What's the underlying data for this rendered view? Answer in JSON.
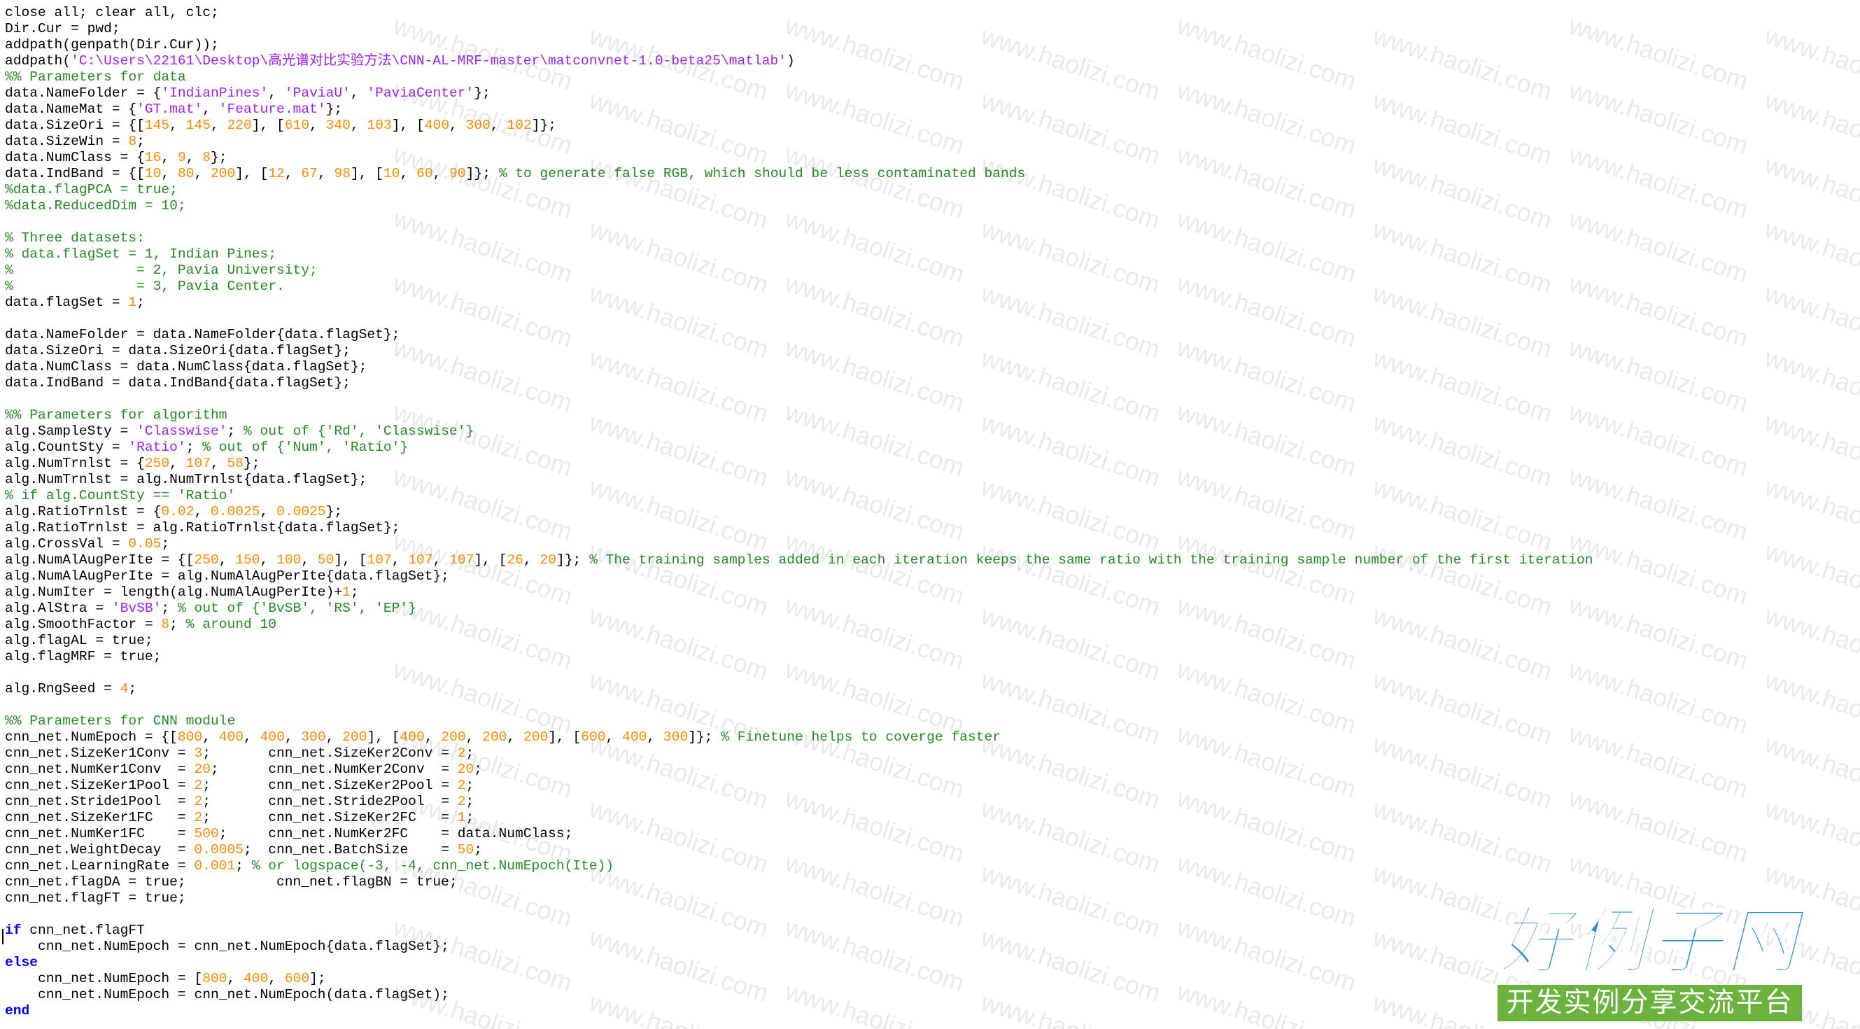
{
  "editor": {
    "colors": {
      "keyword": "#0000ff",
      "string": "#a020f0",
      "comment": "#228b22",
      "number": "#ff8c00",
      "text": "#000000",
      "background": "#ffffff"
    },
    "lines": [
      [
        [
          "t",
          "close all; clear all, clc;"
        ]
      ],
      [
        [
          "t",
          "Dir.Cur = pwd;"
        ]
      ],
      [
        [
          "t",
          "addpath(genpath(Dir.Cur));"
        ]
      ],
      [
        [
          "t",
          "addpath("
        ],
        [
          "s",
          "'C:\\Users\\22161\\Desktop\\高光谱对比实验方法\\CNN-AL-MRF-master\\matconvnet-1.0-beta25\\matlab'"
        ],
        [
          "t",
          ")"
        ]
      ],
      [
        [
          "c",
          "%% Parameters for data"
        ]
      ],
      [
        [
          "t",
          "data.NameFolder = {"
        ],
        [
          "s",
          "'IndianPines'"
        ],
        [
          "t",
          ", "
        ],
        [
          "s",
          "'PaviaU'"
        ],
        [
          "t",
          ", "
        ],
        [
          "s",
          "'PaviaCenter'"
        ],
        [
          "t",
          "};"
        ]
      ],
      [
        [
          "t",
          "data.NameMat = {"
        ],
        [
          "s",
          "'GT.mat'"
        ],
        [
          "t",
          ", "
        ],
        [
          "s",
          "'Feature.mat'"
        ],
        [
          "t",
          "};"
        ]
      ],
      [
        [
          "t",
          "data.SizeOri = {["
        ],
        [
          "n",
          "145"
        ],
        [
          "t",
          ", "
        ],
        [
          "n",
          "145"
        ],
        [
          "t",
          ", "
        ],
        [
          "n",
          "220"
        ],
        [
          "t",
          "], ["
        ],
        [
          "n",
          "610"
        ],
        [
          "t",
          ", "
        ],
        [
          "n",
          "340"
        ],
        [
          "t",
          ", "
        ],
        [
          "n",
          "103"
        ],
        [
          "t",
          "], ["
        ],
        [
          "n",
          "400"
        ],
        [
          "t",
          ", "
        ],
        [
          "n",
          "300"
        ],
        [
          "t",
          ", "
        ],
        [
          "n",
          "102"
        ],
        [
          "t",
          "]};"
        ]
      ],
      [
        [
          "t",
          "data.SizeWin = "
        ],
        [
          "n",
          "8"
        ],
        [
          "t",
          ";"
        ]
      ],
      [
        [
          "t",
          "data.NumClass = {"
        ],
        [
          "n",
          "16"
        ],
        [
          "t",
          ", "
        ],
        [
          "n",
          "9"
        ],
        [
          "t",
          ", "
        ],
        [
          "n",
          "8"
        ],
        [
          "t",
          "};"
        ]
      ],
      [
        [
          "t",
          "data.IndBand = {["
        ],
        [
          "n",
          "10"
        ],
        [
          "t",
          ", "
        ],
        [
          "n",
          "80"
        ],
        [
          "t",
          ", "
        ],
        [
          "n",
          "200"
        ],
        [
          "t",
          "], ["
        ],
        [
          "n",
          "12"
        ],
        [
          "t",
          ", "
        ],
        [
          "n",
          "67"
        ],
        [
          "t",
          ", "
        ],
        [
          "n",
          "98"
        ],
        [
          "t",
          "], ["
        ],
        [
          "n",
          "10"
        ],
        [
          "t",
          ", "
        ],
        [
          "n",
          "60"
        ],
        [
          "t",
          ", "
        ],
        [
          "n",
          "90"
        ],
        [
          "t",
          "]}; "
        ],
        [
          "c",
          "% to generate false RGB, which should be less contaminated bands"
        ]
      ],
      [
        [
          "c",
          "%data.flagPCA = true;"
        ]
      ],
      [
        [
          "c",
          "%data.ReducedDim = 10;"
        ]
      ],
      [],
      [
        [
          "c",
          "% Three datasets:"
        ]
      ],
      [
        [
          "c",
          "% data.flagSet = 1, Indian Pines;"
        ]
      ],
      [
        [
          "c",
          "%               = 2, Pavia University;"
        ]
      ],
      [
        [
          "c",
          "%               = 3, Pavia Center."
        ]
      ],
      [
        [
          "t",
          "data.flagSet = "
        ],
        [
          "n",
          "1"
        ],
        [
          "t",
          ";"
        ]
      ],
      [],
      [
        [
          "t",
          "data.NameFolder = data.NameFolder{data.flagSet};"
        ]
      ],
      [
        [
          "t",
          "data.SizeOri = data.SizeOri{data.flagSet};"
        ]
      ],
      [
        [
          "t",
          "data.NumClass = data.NumClass{data.flagSet};"
        ]
      ],
      [
        [
          "t",
          "data.IndBand = data.IndBand{data.flagSet};"
        ]
      ],
      [],
      [
        [
          "c",
          "%% Parameters for algorithm"
        ]
      ],
      [
        [
          "t",
          "alg.SampleSty = "
        ],
        [
          "s",
          "'Classwise'"
        ],
        [
          "t",
          "; "
        ],
        [
          "c",
          "% out of {'Rd', 'Classwise'}"
        ]
      ],
      [
        [
          "t",
          "alg.CountSty = "
        ],
        [
          "s",
          "'Ratio'"
        ],
        [
          "t",
          "; "
        ],
        [
          "c",
          "% out of {'Num', 'Ratio'}"
        ]
      ],
      [
        [
          "t",
          "alg.NumTrnlst = {"
        ],
        [
          "n",
          "250"
        ],
        [
          "t",
          ", "
        ],
        [
          "n",
          "107"
        ],
        [
          "t",
          ", "
        ],
        [
          "n",
          "58"
        ],
        [
          "t",
          "};"
        ]
      ],
      [
        [
          "t",
          "alg.NumTrnlst = alg.NumTrnlst{data.flagSet};"
        ]
      ],
      [
        [
          "c",
          "% if alg.CountSty == 'Ratio'"
        ]
      ],
      [
        [
          "t",
          "alg.RatioTrnlst = {"
        ],
        [
          "n",
          "0.02"
        ],
        [
          "t",
          ", "
        ],
        [
          "n",
          "0.0025"
        ],
        [
          "t",
          ", "
        ],
        [
          "n",
          "0.0025"
        ],
        [
          "t",
          "};"
        ]
      ],
      [
        [
          "t",
          "alg.RatioTrnlst = alg.RatioTrnlst{data.flagSet};"
        ]
      ],
      [
        [
          "t",
          "alg.CrossVal = "
        ],
        [
          "n",
          "0.05"
        ],
        [
          "t",
          ";"
        ]
      ],
      [
        [
          "t",
          "alg.NumAlAugPerIte = {["
        ],
        [
          "n",
          "250"
        ],
        [
          "t",
          ", "
        ],
        [
          "n",
          "150"
        ],
        [
          "t",
          ", "
        ],
        [
          "n",
          "100"
        ],
        [
          "t",
          ", "
        ],
        [
          "n",
          "50"
        ],
        [
          "t",
          "], ["
        ],
        [
          "n",
          "107"
        ],
        [
          "t",
          ", "
        ],
        [
          "n",
          "107"
        ],
        [
          "t",
          ", "
        ],
        [
          "n",
          "107"
        ],
        [
          "t",
          "], ["
        ],
        [
          "n",
          "26"
        ],
        [
          "t",
          ", "
        ],
        [
          "n",
          "20"
        ],
        [
          "t",
          "]}; "
        ],
        [
          "c",
          "% The training samples added in each iteration keeps the same ratio with the training sample number of the first iteration"
        ]
      ],
      [
        [
          "t",
          "alg.NumAlAugPerIte = alg.NumAlAugPerIte{data.flagSet};"
        ]
      ],
      [
        [
          "t",
          "alg.NumIter = length(alg.NumAlAugPerIte)+"
        ],
        [
          "n",
          "1"
        ],
        [
          "t",
          ";"
        ]
      ],
      [
        [
          "t",
          "alg.AlStra = "
        ],
        [
          "s",
          "'BvSB'"
        ],
        [
          "t",
          "; "
        ],
        [
          "c",
          "% out of {'BvSB', 'RS', 'EP'}"
        ]
      ],
      [
        [
          "t",
          "alg.SmoothFactor = "
        ],
        [
          "n",
          "8"
        ],
        [
          "t",
          "; "
        ],
        [
          "c",
          "% around 10"
        ]
      ],
      [
        [
          "t",
          "alg.flagAL = true;"
        ]
      ],
      [
        [
          "t",
          "alg.flagMRF = true;"
        ]
      ],
      [],
      [
        [
          "t",
          "alg.RngSeed = "
        ],
        [
          "n",
          "4"
        ],
        [
          "t",
          ";"
        ]
      ],
      [],
      [
        [
          "c",
          "%% Parameters for CNN module"
        ]
      ],
      [
        [
          "t",
          "cnn_net.NumEpoch = {["
        ],
        [
          "n",
          "800"
        ],
        [
          "t",
          ", "
        ],
        [
          "n",
          "400"
        ],
        [
          "t",
          ", "
        ],
        [
          "n",
          "400"
        ],
        [
          "t",
          ", "
        ],
        [
          "n",
          "300"
        ],
        [
          "t",
          ", "
        ],
        [
          "n",
          "200"
        ],
        [
          "t",
          "], ["
        ],
        [
          "n",
          "400"
        ],
        [
          "t",
          ", "
        ],
        [
          "n",
          "200"
        ],
        [
          "t",
          ", "
        ],
        [
          "n",
          "200"
        ],
        [
          "t",
          ", "
        ],
        [
          "n",
          "200"
        ],
        [
          "t",
          "], ["
        ],
        [
          "n",
          "600"
        ],
        [
          "t",
          ", "
        ],
        [
          "n",
          "400"
        ],
        [
          "t",
          ", "
        ],
        [
          "n",
          "300"
        ],
        [
          "t",
          "]}; "
        ],
        [
          "c",
          "% Finetune helps to coverge faster"
        ]
      ],
      [
        [
          "t",
          "cnn_net.SizeKer1Conv = "
        ],
        [
          "n",
          "3"
        ],
        [
          "t",
          ";       cnn_net.SizeKer2Conv = "
        ],
        [
          "n",
          "2"
        ],
        [
          "t",
          ";"
        ]
      ],
      [
        [
          "t",
          "cnn_net.NumKer1Conv  = "
        ],
        [
          "n",
          "20"
        ],
        [
          "t",
          ";      cnn_net.NumKer2Conv  = "
        ],
        [
          "n",
          "20"
        ],
        [
          "t",
          ";"
        ]
      ],
      [
        [
          "t",
          "cnn_net.SizeKer1Pool = "
        ],
        [
          "n",
          "2"
        ],
        [
          "t",
          ";       cnn_net.SizeKer2Pool = "
        ],
        [
          "n",
          "2"
        ],
        [
          "t",
          ";"
        ]
      ],
      [
        [
          "t",
          "cnn_net.Stride1Pool  = "
        ],
        [
          "n",
          "2"
        ],
        [
          "t",
          ";       cnn_net.Stride2Pool  = "
        ],
        [
          "n",
          "2"
        ],
        [
          "t",
          ";"
        ]
      ],
      [
        [
          "t",
          "cnn_net.SizeKer1FC   = "
        ],
        [
          "n",
          "2"
        ],
        [
          "t",
          ";       cnn_net.SizeKer2FC   = "
        ],
        [
          "n",
          "1"
        ],
        [
          "t",
          ";"
        ]
      ],
      [
        [
          "t",
          "cnn_net.NumKer1FC    = "
        ],
        [
          "n",
          "500"
        ],
        [
          "t",
          ";     cnn_net.NumKer2FC    = data.NumClass;"
        ]
      ],
      [
        [
          "t",
          "cnn_net.WeightDecay  = "
        ],
        [
          "n",
          "0.0005"
        ],
        [
          "t",
          ";  cnn_net.BatchSize    = "
        ],
        [
          "n",
          "50"
        ],
        [
          "t",
          ";"
        ]
      ],
      [
        [
          "t",
          "cnn_net.LearningRate = "
        ],
        [
          "n",
          "0.001"
        ],
        [
          "t",
          "; "
        ],
        [
          "c",
          "% or logspace(-3, -4, cnn_net.NumEpoch(Ite))"
        ]
      ],
      [
        [
          "t",
          "cnn_net.flagDA = true;           cnn_net.flagBN = true;"
        ]
      ],
      [
        [
          "t",
          "cnn_net.flagFT = true;"
        ]
      ],
      [],
      [
        [
          "k",
          "if"
        ],
        [
          "t",
          " cnn_net.flagFT"
        ]
      ],
      [
        [
          "t",
          "    cnn_net.NumEpoch = cnn_net.NumEpoch{data.flagSet};"
        ]
      ],
      [
        [
          "k",
          "else"
        ]
      ],
      [
        [
          "t",
          "    cnn_net.NumEpoch = ["
        ],
        [
          "n",
          "800"
        ],
        [
          "t",
          ", "
        ],
        [
          "n",
          "400"
        ],
        [
          "t",
          ", "
        ],
        [
          "n",
          "600"
        ],
        [
          "t",
          "];"
        ]
      ],
      [
        [
          "t",
          "    cnn_net.NumEpoch = cnn_net.NumEpoch(data.flagSet);"
        ]
      ],
      [
        [
          "k",
          "end"
        ]
      ]
    ]
  },
  "watermark": {
    "text": "www.haolizi.com"
  },
  "logo": {
    "title": "好例子网",
    "subtitle": "开发实例分享交流平台",
    "title_color": "#2b8fd6",
    "subtitle_bg": "#6cb33e"
  }
}
